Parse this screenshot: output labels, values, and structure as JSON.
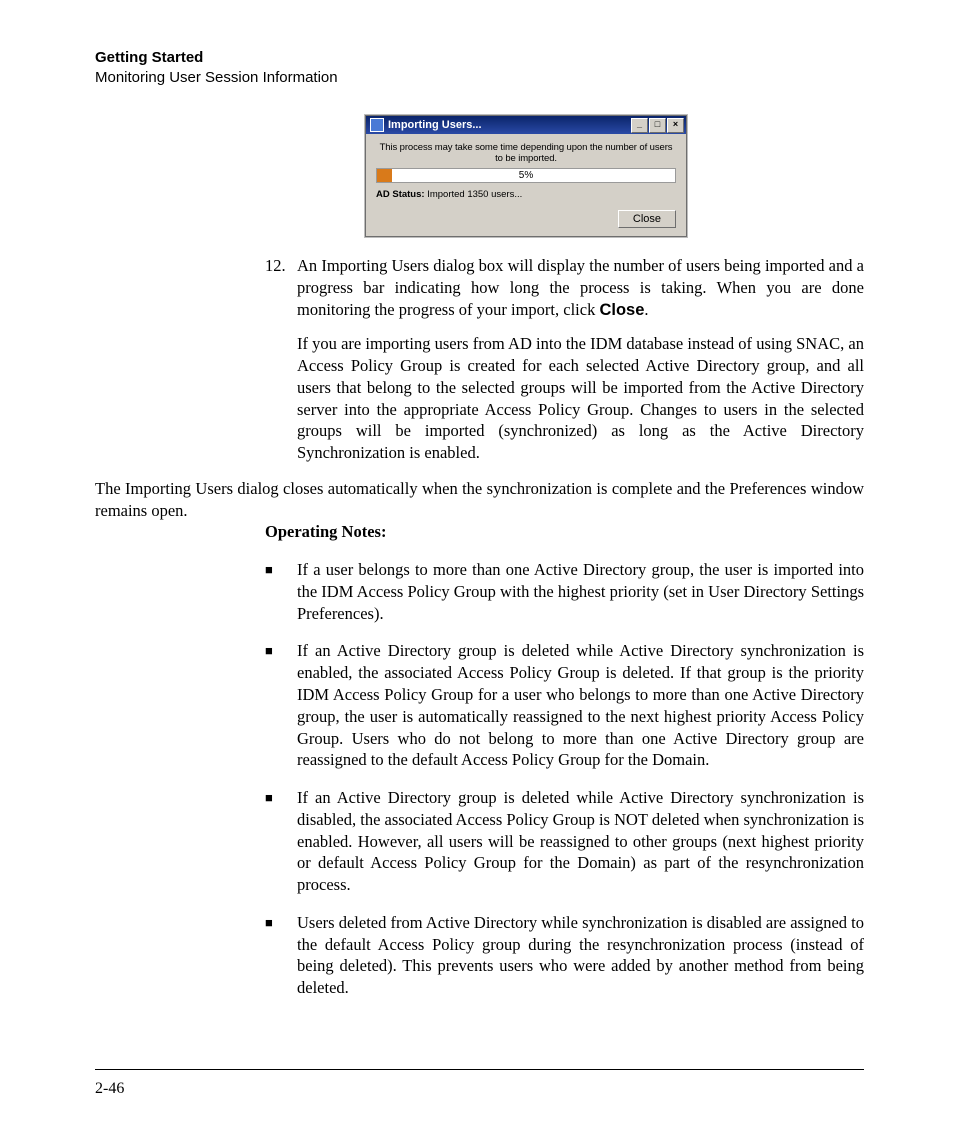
{
  "header": {
    "title": "Getting Started",
    "subtitle": "Monitoring User Session Information"
  },
  "dialog": {
    "title": "Importing Users...",
    "min_label": "_",
    "max_label": "□",
    "close_x": "×",
    "message": "This process may take some time depending upon the number of users to be imported.",
    "progress_percent": "5%",
    "status_label": "AD Status:",
    "status_value": "Imported 1350 users...",
    "close_button": "Close"
  },
  "step12": {
    "number": "12.",
    "para1_a": "An Importing Users dialog box will display the number of users being imported and a progress bar indicating how long the process is taking. When you are done monitoring the progress of your import, click ",
    "para1_bold": "Close",
    "para1_b": ".",
    "para2": "If you are importing users from AD into the IDM database instead of using SNAC, an Access Policy Group is created for each selected Active Directory group, and all users that belong to the selected groups will be imported from the Active Directory server into the appropriate Access Policy Group. Changes to users in the selected groups will be imported (synchronized) as long as the Active Directory Synchronization is enabled."
  },
  "closing_para": "The Importing Users dialog closes automatically when the synchronization is complete and the Preferences window remains open.",
  "opnotes_heading": "Operating Notes:",
  "bullets": [
    "If a user belongs to more than one Active Directory group, the user is imported into the IDM Access Policy Group with the highest priority (set in User Directory Settings Preferences).",
    "If an Active Directory group is deleted while Active Directory synchroni­zation is enabled, the associated Access Policy Group is deleted. If that group is the priority IDM Access Policy Group for a user who belongs to more than one Active Directory group, the user is automatically reassigned to the next highest priority Access Policy Group. Users who do not belong to more than one Active Directory group are reassigned to the default Access Policy Group for the Domain.",
    "If an Active Directory group is deleted while Active Directory synchroni­zation is disabled, the associated Access Policy Group is NOT deleted when synchronization is enabled. However, all users will be reassigned to other groups (next highest priority or default Access Policy Group for the Domain) as part of the resynchronization process.",
    "Users deleted from Active Directory while synchronization is disabled are assigned to the default Access Policy group during the resynchronization process (instead of being deleted). This prevents users who were added by another method from being deleted."
  ],
  "page_number": "2-46"
}
